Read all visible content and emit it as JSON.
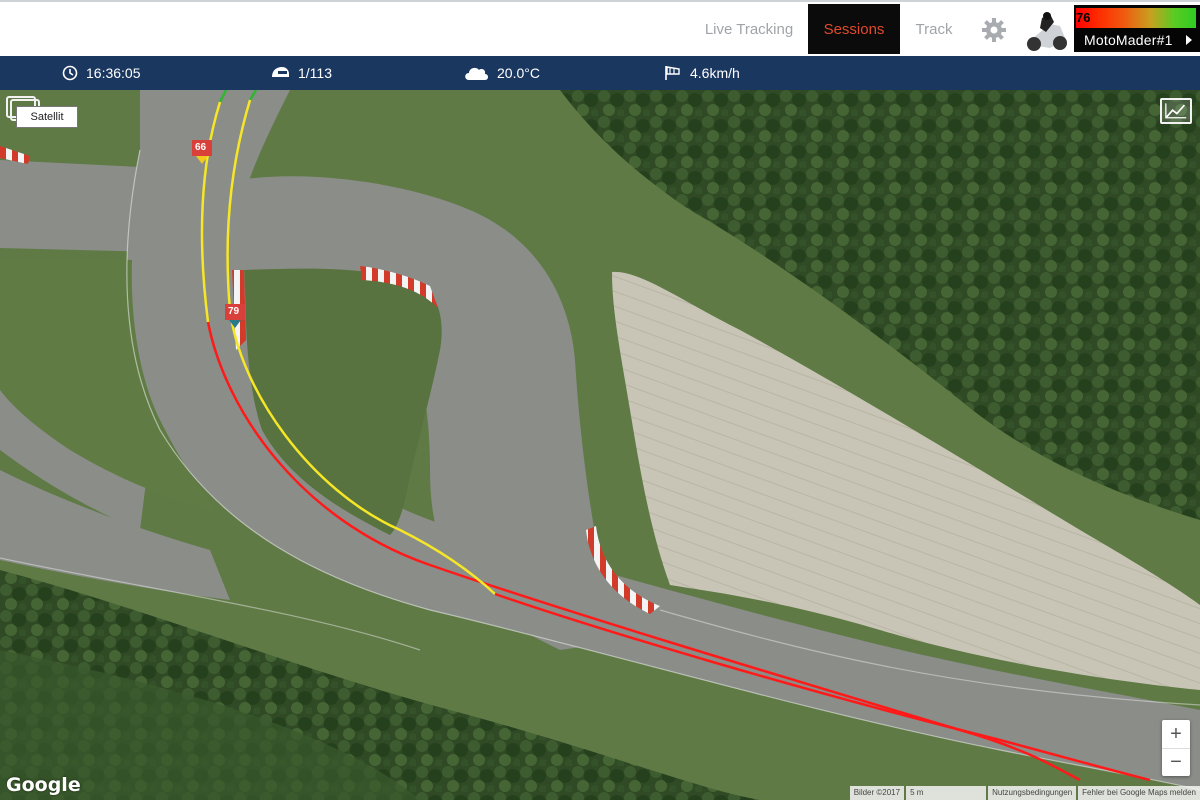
{
  "nav": {
    "live_tracking": "Live Tracking",
    "sessions": "Sessions",
    "track": "Track",
    "settings_icon": "gear-icon"
  },
  "rider": {
    "number": "76",
    "name": "MotoMader#1",
    "bar_colors": [
      "#ff0000",
      "#2ecc24"
    ]
  },
  "status": {
    "time": "16:36:05",
    "lap": "1/113",
    "temperature": "20.0°C",
    "wind": "4.6km/h"
  },
  "map": {
    "layer_label": "Satellit",
    "markers": [
      {
        "label": "66"
      },
      {
        "label": "79"
      }
    ],
    "zoom_in": "+",
    "zoom_out": "−",
    "logo": "Google",
    "credits": {
      "imagery": "Bilder ©2017",
      "scale": "5 m",
      "terms": "Nutzungsbedingungen",
      "report": "Fehler bei Google Maps melden"
    }
  },
  "colors": {
    "accent": "#e04a2a",
    "status_bar": "#1a3760",
    "line_slow": "#ff1a1a",
    "line_fast": "#f6e628",
    "line_start": "#2db82d"
  }
}
